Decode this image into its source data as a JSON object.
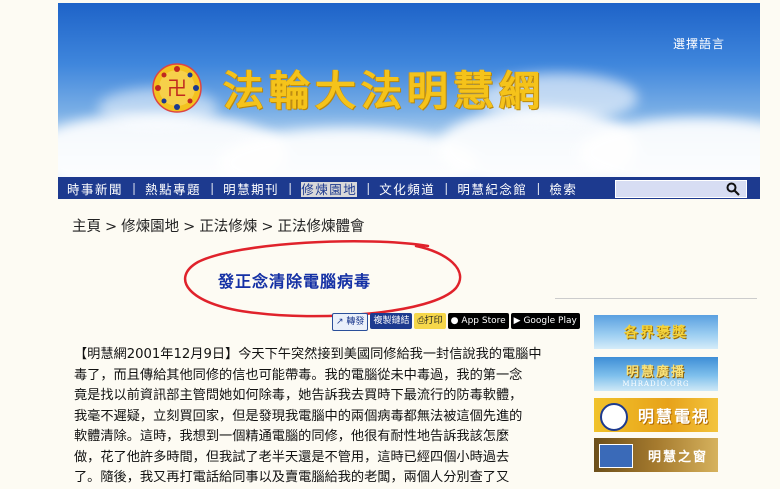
{
  "header": {
    "site_title": "法輪大法明慧網",
    "language_select": "選擇語言"
  },
  "nav": {
    "items": [
      "時事新聞",
      "熱點專題",
      "明慧期刊",
      "修煉園地",
      "文化頻道",
      "明慧紀念館",
      "檢索"
    ],
    "separator": "|",
    "active_index": 3,
    "search_placeholder": ""
  },
  "breadcrumb": {
    "items": [
      "主頁",
      "修煉園地",
      "正法修煉",
      "正法修煉體會"
    ],
    "separator": ">"
  },
  "article": {
    "title": "發正念清除電腦病毒",
    "share_buttons": [
      "轉發",
      "複製鏈結",
      "打印",
      "App Store",
      "Google Play"
    ],
    "paragraph_lines": [
      "【明慧網2001年12月9日】今天下午突然接到美國同修給我一封信說我的電腦中",
      "毒了，而且傳給其他同修的信也可能帶毒。我的電腦從未中毒過，我的第一念",
      "竟是找以前資訊部主管問她如何除毒，她告訴我去買時下最流行的防毒軟體，",
      "我毫不遲疑，立刻買回家，但是發現我電腦中的兩個病毒都無法被這個先進的",
      "軟體清除。這時，我想到一個精通電腦的同修，他很有耐性地告訴我該怎麼",
      "做，花了他許多時間，但我試了老半天還是不管用，這時已經四個小時過去",
      "了。隨後，我又再打電話給同事以及賣電腦給我的老闆，兩個人分別查了又"
    ]
  },
  "sidebar": {
    "banners": [
      "各界褒獎",
      "明慧廣播",
      "明慧電視",
      "明慧之窗"
    ],
    "banner_sublabels": [
      "",
      "MHRADIO.ORG",
      "",
      ""
    ]
  },
  "colors": {
    "nav_bg": "#1d3a8f",
    "title_blue": "#1531a5",
    "title_gold": "#f5c31a",
    "annotation_red": "#e0222b"
  }
}
